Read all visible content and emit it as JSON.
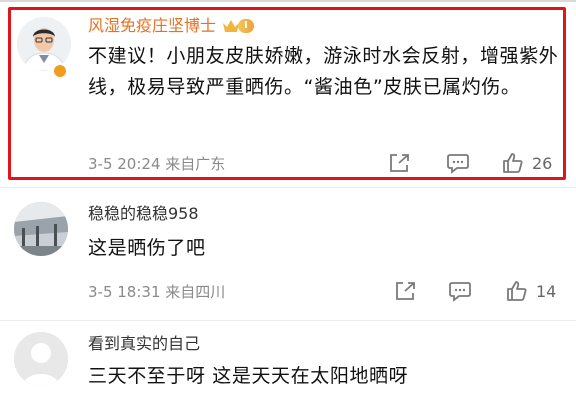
{
  "comments": [
    {
      "username": "风湿免疫庄坚博士",
      "badge_level": "I",
      "text": "不建议！小朋友皮肤娇嫩，游泳时水会反射，增强紫外线，极易导致严重晒伤。“酱油色”皮肤已属灼伤。",
      "meta": "3-5 20:24  来自广东",
      "like_count": "26",
      "highlight_color": "#e0151b",
      "username_color": "#e8711f"
    },
    {
      "username": "稳稳的稳稳958",
      "text": "这是晒伤了吧",
      "meta": "3-5 18:31  来自四川",
      "like_count": "14"
    },
    {
      "username": "看到真实的自己",
      "text": "三天不至于呀 这是天天在太阳地晒呀"
    }
  ],
  "icons": {
    "share": "share-icon",
    "comment": "comment-icon",
    "like": "like-icon"
  }
}
